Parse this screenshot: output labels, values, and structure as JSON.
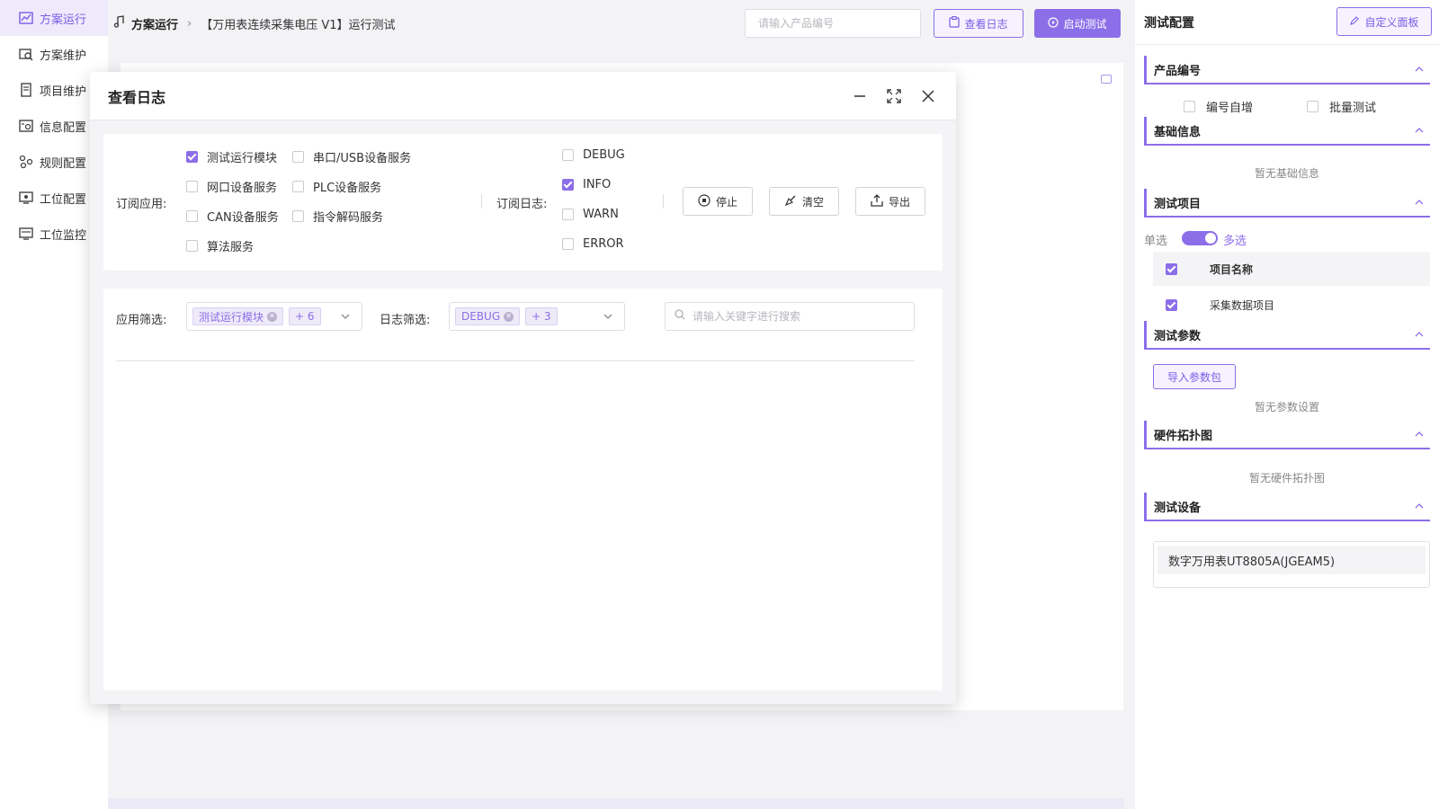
{
  "sidebar": {
    "items": [
      {
        "label": "方案运行",
        "active": true
      },
      {
        "label": "方案维护"
      },
      {
        "label": "项目维护"
      },
      {
        "label": "信息配置"
      },
      {
        "label": "规则配置"
      },
      {
        "label": "工位配置"
      },
      {
        "label": "工位监控"
      }
    ]
  },
  "header": {
    "breadcrumb_root": "方案运行",
    "breadcrumb_current": "【万用表连续采集电压 V1】运行测试",
    "product_placeholder": "请输入产品编号",
    "view_log_label": "查看日志",
    "start_test_label": "启动测试"
  },
  "modal": {
    "title": "查看日志",
    "subscribe_app_label": "订阅应用:",
    "apps": [
      {
        "label": "测试运行模块",
        "checked": true
      },
      {
        "label": "串口/USB设备服务",
        "checked": false
      },
      {
        "label": "网口设备服务",
        "checked": false
      },
      {
        "label": "PLC设备服务",
        "checked": false
      },
      {
        "label": "CAN设备服务",
        "checked": false
      },
      {
        "label": "指令解码服务",
        "checked": false
      },
      {
        "label": "算法服务",
        "checked": false
      }
    ],
    "subscribe_log_label": "订阅日志:",
    "levels": [
      {
        "label": "DEBUG",
        "checked": false
      },
      {
        "label": "INFO",
        "checked": true
      },
      {
        "label": "WARN",
        "checked": false
      },
      {
        "label": "ERROR",
        "checked": false
      }
    ],
    "stop_label": "停止",
    "clear_label": "清空",
    "export_label": "导出",
    "app_filter_label": "应用筛选:",
    "app_filter_tag": "测试运行模块",
    "app_filter_more": "+ 6",
    "log_filter_label": "日志筛选:",
    "log_filter_tag": "DEBUG",
    "log_filter_more": "+ 3",
    "keyword_placeholder": "请输入关键字进行搜索"
  },
  "right_panel": {
    "title": "测试配置",
    "custom_panel_label": "自定义面板",
    "product_section": "产品编号",
    "auto_increment_label": "编号自增",
    "batch_test_label": "批量测试",
    "basic_section": "基础信息",
    "basic_empty": "暂无基础信息",
    "items_section": "测试项目",
    "single_label": "单选",
    "multi_label": "多选",
    "item_header": "项目名称",
    "item_row": "采集数据项目",
    "params_section": "测试参数",
    "import_label": "导入参数包",
    "params_empty": "暂无参数设置",
    "topology_section": "硬件拓扑图",
    "topology_empty": "暂无硬件拓扑图",
    "devices_section": "测试设备",
    "device_name": "数字万用表UT8805A(JGEAM5)"
  },
  "colors": {
    "accent": "#8c6ee9",
    "accent_light": "#f6f2ff"
  }
}
